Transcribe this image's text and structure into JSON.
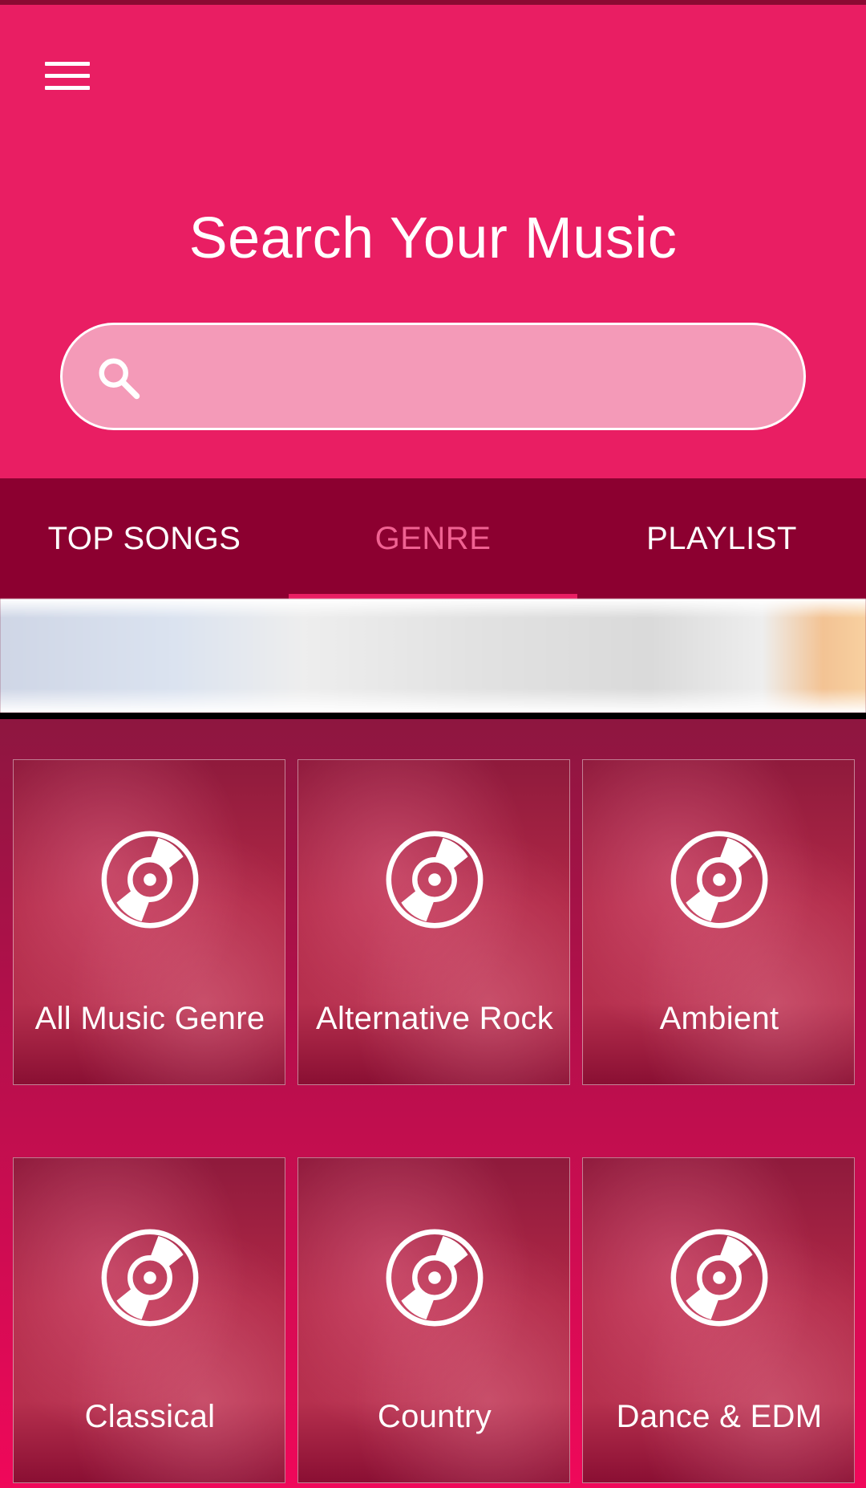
{
  "header": {
    "title": "Search Your Music",
    "menu_icon": "hamburger-menu-icon"
  },
  "search": {
    "placeholder": "",
    "value": "",
    "icon": "search-icon"
  },
  "tabs": [
    {
      "label": "TOP SONGS",
      "active": false
    },
    {
      "label": "GENRE",
      "active": true
    },
    {
      "label": "PLAYLIST",
      "active": false
    }
  ],
  "genres": [
    {
      "label": "All Music Genre",
      "icon": "disc-icon"
    },
    {
      "label": "Alternative Rock",
      "icon": "disc-icon"
    },
    {
      "label": "Ambient",
      "icon": "disc-icon"
    },
    {
      "label": "Classical",
      "icon": "disc-icon"
    },
    {
      "label": "Country",
      "icon": "disc-icon"
    },
    {
      "label": "Dance & EDM",
      "icon": "disc-icon"
    }
  ],
  "colors": {
    "primary": "#e91e63",
    "tab_bar": "#8c0030",
    "active_tab_text": "#f06292",
    "search_fill": "#f49ab8"
  }
}
